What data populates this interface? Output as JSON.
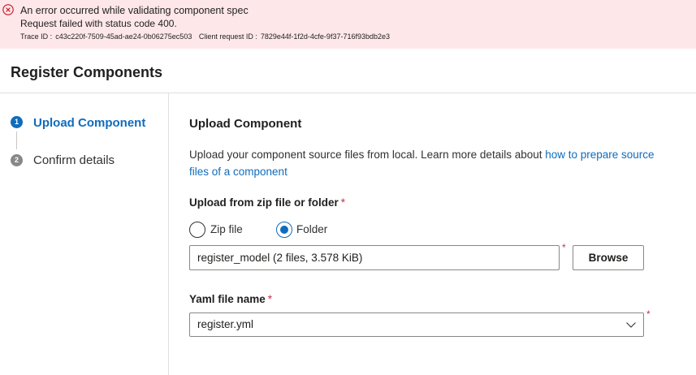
{
  "banner": {
    "icon": "error-circle-icon",
    "title": "An error occurred while validating component spec",
    "message": "Request failed with status code 400.",
    "trace_label": "Trace ID :",
    "trace_id": "c43c220f-7509-45ad-ae24-0b06275ec503",
    "client_label": "Client request ID :",
    "client_id": "7829e44f-1f2d-4cfe-9f37-716f93bdb2e3",
    "colors": {
      "background": "#fde7e9",
      "icon": "#c50f1f"
    }
  },
  "header": {
    "title": "Register Components"
  },
  "stepper": {
    "steps": [
      {
        "number": "1",
        "label": "Upload Component",
        "state": "active"
      },
      {
        "number": "2",
        "label": "Confirm details",
        "state": "pending"
      }
    ],
    "colors": {
      "active": "#0f6cbd",
      "pending": "#8a8886"
    }
  },
  "main": {
    "title": "Upload Component",
    "description": "Upload your component source files from local. Learn more details about ",
    "link_text": "how to prepare source files of a component",
    "upload": {
      "label": "Upload from zip file or folder",
      "required_mark": "*",
      "options": [
        {
          "label": "Zip file",
          "selected": false
        },
        {
          "label": "Folder",
          "selected": true
        }
      ],
      "value": "register_model (2 files, 3.578 KiB)",
      "browse_label": "Browse"
    },
    "yaml": {
      "label": "Yaml file name",
      "required_mark": "*",
      "selected": "register.yml",
      "icon": "chevron-down-icon"
    }
  }
}
